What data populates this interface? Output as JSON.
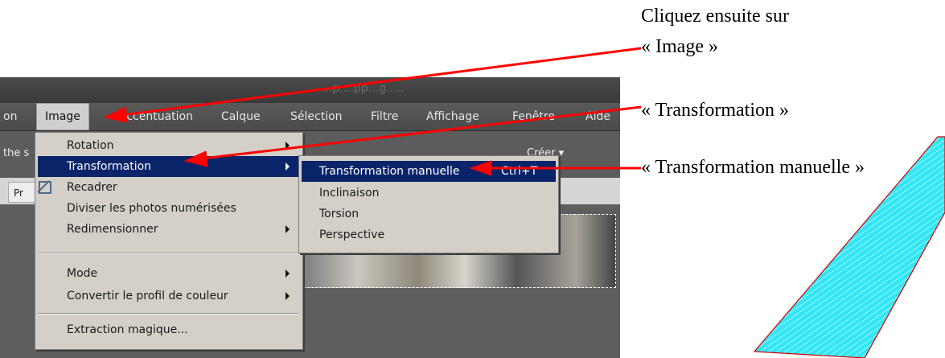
{
  "window": {
    "title": "...p....pp...g....."
  },
  "menubar": {
    "items": [
      {
        "label": "on"
      },
      {
        "label": "Image"
      },
      {
        "label": "Accentuation"
      },
      {
        "label": "Calque"
      },
      {
        "label": "Sélection"
      },
      {
        "label": "Filtre"
      },
      {
        "label": "Affichage"
      },
      {
        "label": "Fenêtre"
      },
      {
        "label": "Aide"
      }
    ]
  },
  "toolbar": {
    "left_text": "the s",
    "create_label": "Créer ▾"
  },
  "tab": {
    "label": "Pr"
  },
  "image_menu": {
    "items": [
      {
        "label": "Rotation",
        "submenu": true
      },
      {
        "label": "Transformation",
        "submenu": true,
        "selected": true
      },
      {
        "label": "Recadrer",
        "icon": "crop-icon"
      },
      {
        "label": "Diviser les photos numérisées"
      },
      {
        "label": "Redimensionner",
        "submenu": true
      },
      {
        "label": "Mode",
        "submenu": true
      },
      {
        "label": "Convertir le profil de couleur",
        "submenu": true
      },
      {
        "label": "Extraction magique..."
      }
    ]
  },
  "transform_submenu": {
    "items": [
      {
        "label": "Transformation manuelle",
        "shortcut": "Ctrl+T",
        "selected": true
      },
      {
        "label": "Inclinaison"
      },
      {
        "label": "Torsion"
      },
      {
        "label": "Perspective"
      }
    ]
  },
  "annotations": {
    "step1_line1": "Cliquez ensuite sur",
    "step1_line2": "« Image »",
    "step2": "« Transformation »",
    "step3": "« Transformation manuelle »"
  },
  "colors": {
    "arrow": "#ff0000",
    "highlight": "#0a246a",
    "shape_fill": "#33e6f5",
    "shape_border": "#cc0000"
  }
}
